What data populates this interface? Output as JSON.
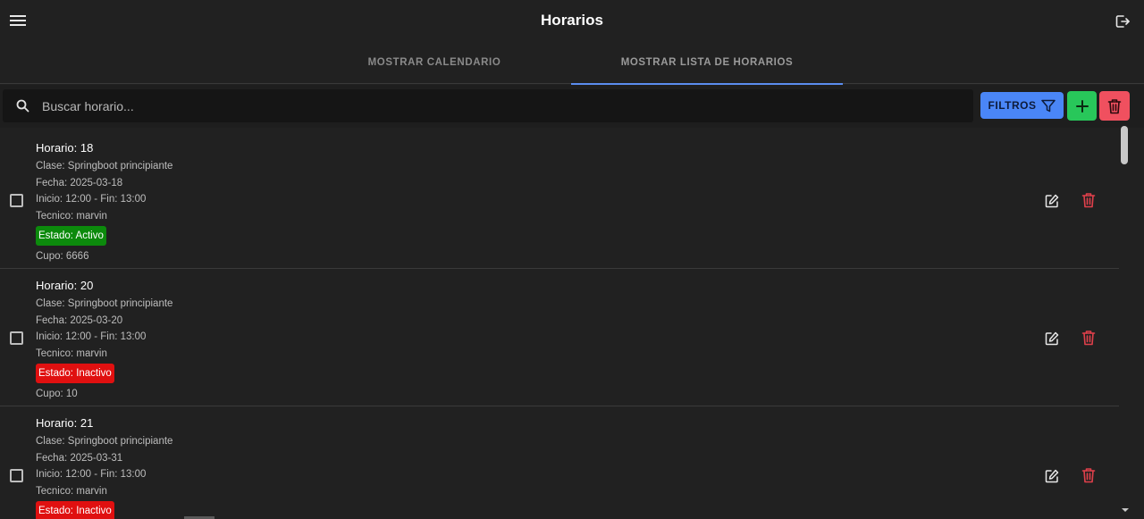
{
  "header": {
    "title": "Horarios",
    "menu_icon": "menu-icon",
    "logout_icon": "logout-icon"
  },
  "tabs": [
    {
      "label": "MOSTRAR CALENDARIO",
      "active": false
    },
    {
      "label": "MOSTRAR LISTA DE HORARIOS",
      "active": true
    }
  ],
  "toolbar": {
    "search_placeholder": "Buscar horario...",
    "filter_label": "FILTROS",
    "colors": {
      "filter": "#4a86f7",
      "add": "#28c75a",
      "delete": "#f0505f"
    }
  },
  "items": [
    {
      "title": "Horario: 18",
      "clase": "Clase: Springboot principiante",
      "fecha": "Fecha: 2025-03-18",
      "horas": "Inicio: 12:00 - Fin: 13:00",
      "tecnico": "Tecnico: marvin",
      "estado": "Estado: Activo",
      "estado_color": "#0c8a0c",
      "cupo": "Cupo: 6666"
    },
    {
      "title": "Horario: 20",
      "clase": "Clase: Springboot principiante",
      "fecha": "Fecha: 2025-03-20",
      "horas": "Inicio: 12:00 - Fin: 13:00",
      "tecnico": "Tecnico: marvin",
      "estado": "Estado: Inactivo",
      "estado_color": "#e01010",
      "cupo": "Cupo: 10"
    },
    {
      "title": "Horario: 21",
      "clase": "Clase: Springboot principiante",
      "fecha": "Fecha: 2025-03-31",
      "horas": "Inicio: 12:00 - Fin: 13:00",
      "tecnico": "Tecnico: marvin",
      "estado": "Estado: Inactivo",
      "estado_color": "#e01010",
      "cupo": ""
    }
  ]
}
